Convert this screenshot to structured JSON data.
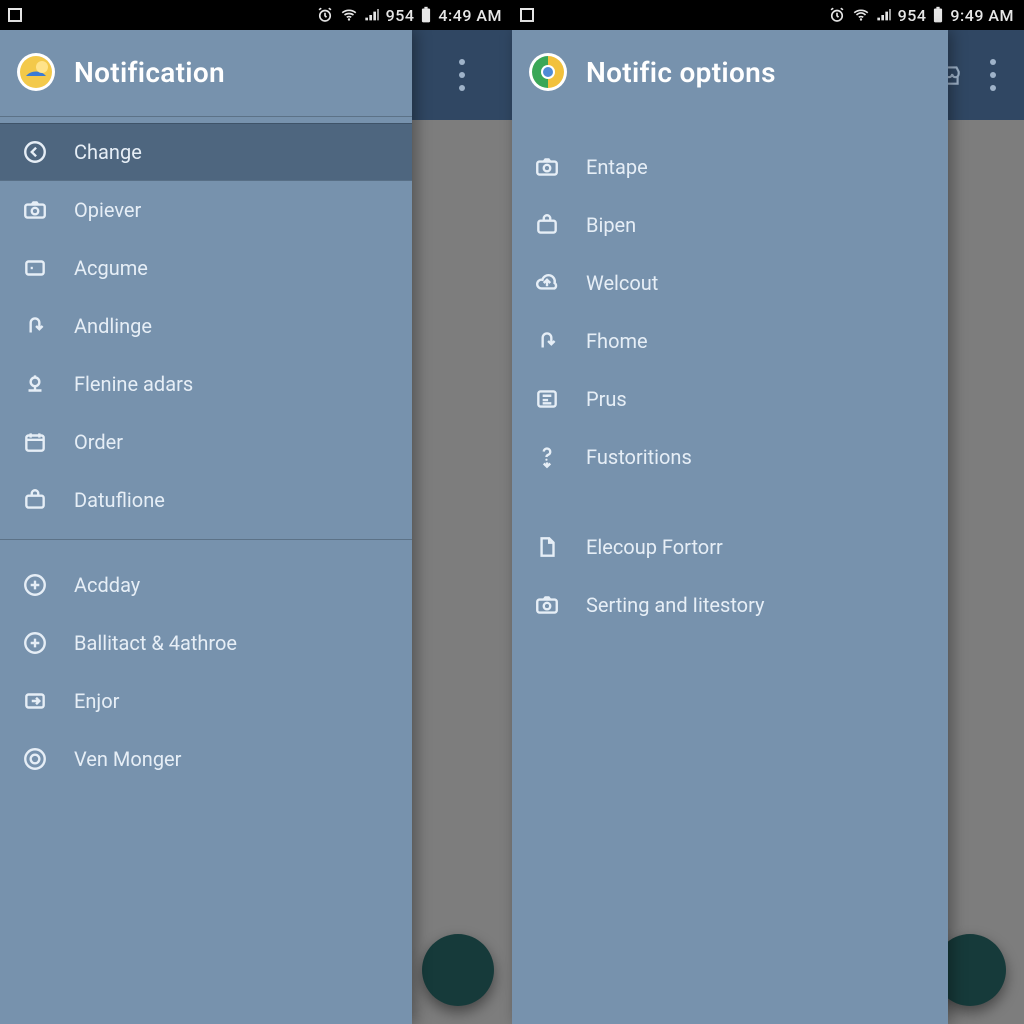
{
  "status": {
    "num": "954",
    "time_left": "4:49 AM",
    "time_right": "9:49 AM"
  },
  "left": {
    "title": "Notification",
    "items_a": [
      {
        "label": "Change"
      },
      {
        "label": "Opiever"
      },
      {
        "label": "Acgume"
      },
      {
        "label": "Andlinge"
      },
      {
        "label": "Flenine adars"
      },
      {
        "label": "Order"
      },
      {
        "label": "Datuflione"
      }
    ],
    "items_b": [
      {
        "label": "Acdday"
      },
      {
        "label": "Ballitact & 4athroe"
      },
      {
        "label": "Enjor"
      },
      {
        "label": "Ven Monger"
      }
    ]
  },
  "right": {
    "title": "Notific options",
    "items_a": [
      {
        "label": "Entape"
      },
      {
        "label": "Bipen"
      },
      {
        "label": "Welcout"
      },
      {
        "label": "Fhome"
      },
      {
        "label": "Prus"
      },
      {
        "label": "Fustoritions"
      }
    ],
    "items_b": [
      {
        "label": "Elecoup Fortorr"
      },
      {
        "label": "Serting and Iitestory"
      }
    ]
  }
}
